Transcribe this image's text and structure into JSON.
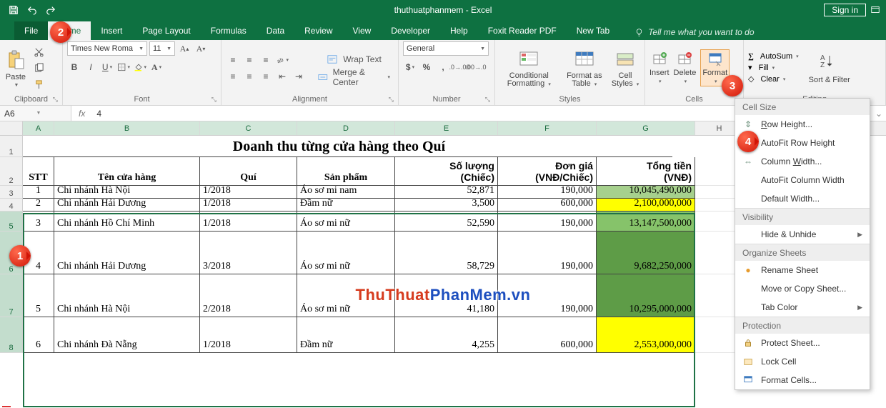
{
  "app": {
    "title": "thuthuatphanmem  -  Excel",
    "signin": "Sign in"
  },
  "tabs": {
    "file": "File",
    "home": "Home",
    "insert": "Insert",
    "page_layout": "Page Layout",
    "formulas": "Formulas",
    "data": "Data",
    "review": "Review",
    "view": "View",
    "developer": "Developer",
    "help": "Help",
    "foxit": "Foxit Reader PDF",
    "newtab": "New Tab",
    "tellme_placeholder": "Tell me what you want to do"
  },
  "ribbon": {
    "clipboard": {
      "paste": "Paste",
      "label": "Clipboard"
    },
    "font": {
      "name": "Times New Roma",
      "size": "11",
      "label": "Font"
    },
    "alignment": {
      "wrap": "Wrap Text",
      "merge": "Merge & Center",
      "label": "Alignment"
    },
    "number": {
      "format": "General",
      "label": "Number"
    },
    "styles": {
      "cond": "Conditional Formatting",
      "fat": "Format as Table",
      "cell": "Cell Styles",
      "label": "Styles"
    },
    "cells": {
      "insert": "Insert",
      "delete": "Delete",
      "format": "Format",
      "label": "Cells"
    },
    "editing": {
      "autosum": "AutoSum",
      "fill": "Fill",
      "clear": "Clear",
      "sort": "Sort & Filter",
      "label": "Editing"
    }
  },
  "fxbar": {
    "name": "A6",
    "formula": "4"
  },
  "columns": [
    "A",
    "B",
    "C",
    "D",
    "E",
    "F",
    "G",
    "H"
  ],
  "table": {
    "title": "Doanh thu từng cửa hàng theo Quí",
    "headers1": {
      "stt": "STT",
      "ten": "Tên cửa hàng",
      "qui": "Quí",
      "sp": "Sản phẩm",
      "sl": "Số lượng",
      "dg": "Đơn giá",
      "tt": "Tổng tiền"
    },
    "headers2": {
      "sl": "(Chiếc)",
      "dg": "(VNĐ/Chiếc)",
      "tt": "(VNĐ)"
    },
    "rows": [
      {
        "n": "3",
        "stt": "1",
        "ten": "Chi nhánh Hà Nội",
        "qui": "1/2018",
        "sp": "Áo sơ mi nam",
        "sl": "52,871",
        "dg": "190,000",
        "tt": "10,045,490,000",
        "bg": "#a6d08d"
      },
      {
        "n": "4",
        "stt": "2",
        "ten": "Chi nhánh Hải Dương",
        "qui": "1/2018",
        "sp": "Đầm nữ",
        "sl": "3,500",
        "dg": "600,000",
        "tt": "2,100,000,000",
        "bg": "#ffff00"
      },
      {
        "n": "5",
        "stt": "3",
        "ten": "Chi nhánh Hồ Chí Minh",
        "qui": "1/2018",
        "sp": "Áo sơ mi nữ",
        "sl": "52,590",
        "dg": "190,000",
        "tt": "13,147,500,000",
        "bg": "#86c36a"
      },
      {
        "n": "6",
        "stt": "4",
        "ten": "Chi nhánh Hải Dương",
        "qui": "3/2018",
        "sp": "Áo sơ mi nữ",
        "sl": "58,729",
        "dg": "190,000",
        "tt": "9,682,250,000",
        "bg": "#5e9c47",
        "tall": true
      },
      {
        "n": "7",
        "stt": "5",
        "ten": "Chi nhánh Hà Nội",
        "qui": "2/2018",
        "sp": "Áo sơ mi nữ",
        "sl": "41,180",
        "dg": "190,000",
        "tt": "10,295,000,000",
        "bg": "#5e9c47",
        "tall": true
      },
      {
        "n": "8",
        "stt": "6",
        "ten": "Chi nhánh Đà Nẵng",
        "qui": "1/2018",
        "sp": "Đầm nữ",
        "sl": "4,255",
        "dg": "600,000",
        "tt": "2,553,000,000",
        "bg": "#ffff00",
        "tall": true
      }
    ]
  },
  "menu": {
    "cellsize": "Cell Size",
    "rowheight": "Row Height...",
    "autofitrow": "AutoFit Row Height",
    "colwidth": "Column Width...",
    "autofitcol": "AutoFit Column Width",
    "defwidth": "Default Width...",
    "visibility": "Visibility",
    "hide": "Hide & Unhide",
    "organize": "Organize Sheets",
    "rename": "Rename Sheet",
    "move": "Move or Copy Sheet...",
    "tabcolor": "Tab Color",
    "protection": "Protection",
    "protect": "Protect Sheet...",
    "lock": "Lock Cell",
    "fmtcells": "Format Cells..."
  },
  "callouts": {
    "c1": "1",
    "c2": "2",
    "c3": "3",
    "c4": "4"
  },
  "watermark": {
    "a": "ThuThuat",
    "b": "PhanMem.vn"
  },
  "rowlabels": {
    "r1": "1",
    "r2": "2"
  }
}
